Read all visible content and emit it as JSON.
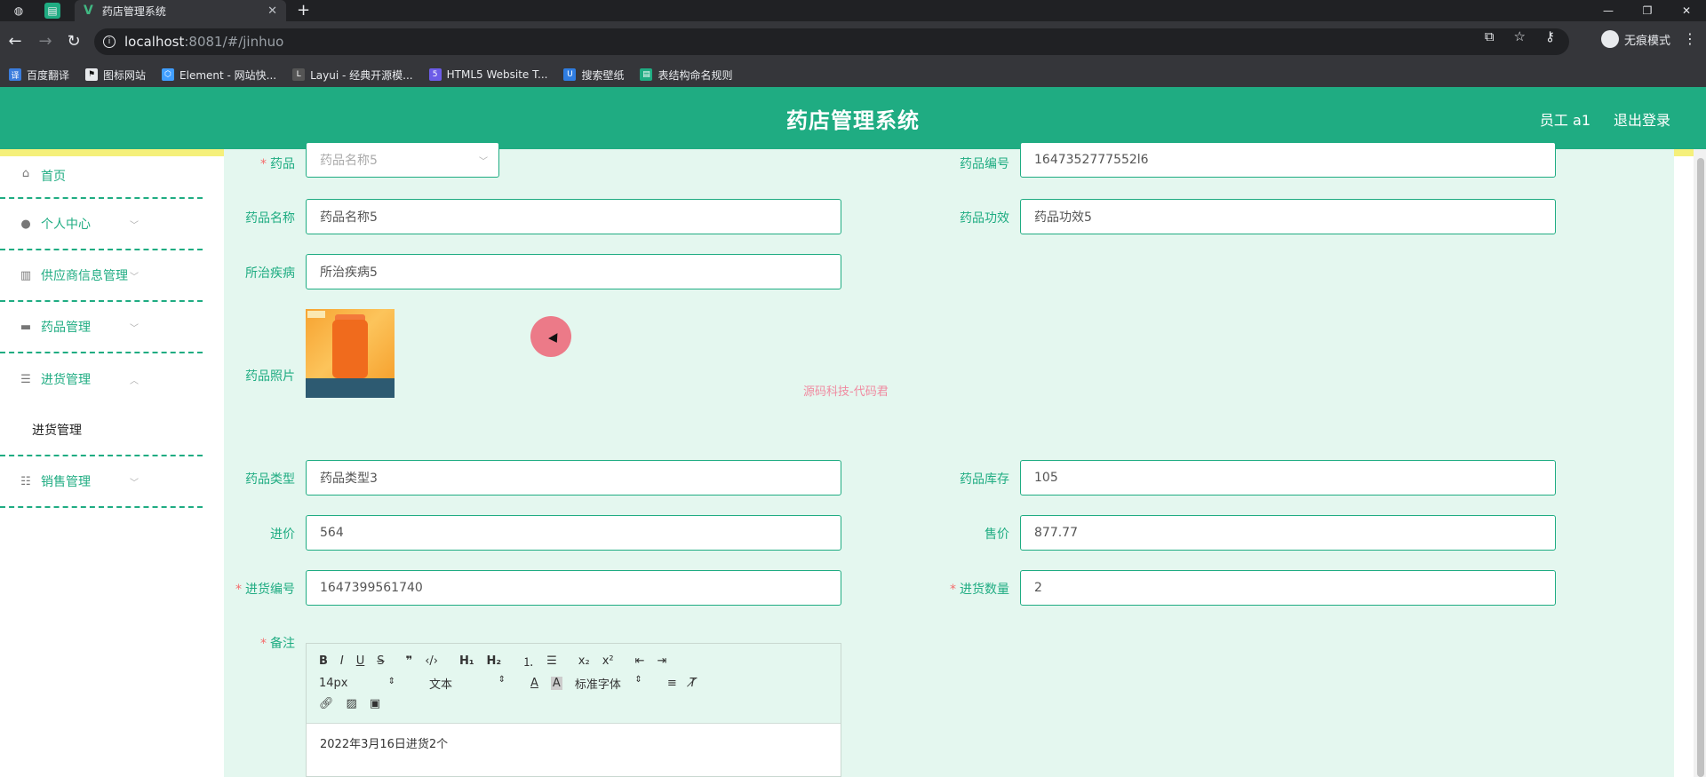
{
  "browser": {
    "tab_title": "药店管理系统",
    "url_host": "localhost",
    "url_rest": ":8081/#/jinhuo",
    "incognito_label": "无痕模式",
    "bookmarks": [
      {
        "label": "百度翻译",
        "color": "#3b7ddd",
        "icon": "translate-icon"
      },
      {
        "label": "图标网站",
        "color": "#111111",
        "icon": "flag-icon"
      },
      {
        "label": "Element - 网站快...",
        "color": "#409eff",
        "icon": "element-icon"
      },
      {
        "label": "Layui - 经典开源模...",
        "color": "#555555",
        "icon": "layui-icon"
      },
      {
        "label": "HTML5 Website T...",
        "color": "#6c5ce7",
        "icon": "html5-icon"
      },
      {
        "label": "搜索壁纸",
        "color": "#2f7de1",
        "icon": "wallpaper-icon"
      },
      {
        "label": "表结构命名规则",
        "color": "#1fac82",
        "icon": "sheet-icon"
      }
    ]
  },
  "header": {
    "title": "药店管理系统",
    "user": "员工 a1",
    "logout": "退出登录",
    "brand_color": "#1fac82"
  },
  "sidebar": {
    "items": [
      {
        "label": "首页",
        "icon": "home-icon"
      },
      {
        "label": "个人中心",
        "icon": "user-icon"
      },
      {
        "label": "供应商信息管理",
        "icon": "supplier-icon"
      },
      {
        "label": "药品管理",
        "icon": "monitor-icon"
      },
      {
        "label": "进货管理",
        "icon": "list-icon",
        "sub": "进货管理"
      },
      {
        "label": "销售管理",
        "icon": "sliders-icon"
      }
    ]
  },
  "form": {
    "drug_select": {
      "label": "药品",
      "value": "药品名称5"
    },
    "drug_code": {
      "label": "药品编号",
      "value": "1647352777552l6"
    },
    "drug_name": {
      "label": "药品名称",
      "value": "药品名称5"
    },
    "drug_effect": {
      "label": "药品功效",
      "value": "药品功效5"
    },
    "disease": {
      "label": "所治疾病",
      "value": "所治疾病5"
    },
    "photo_label": "药品照片",
    "drug_type": {
      "label": "药品类型",
      "value": "药品类型3"
    },
    "stock": {
      "label": "药品库存",
      "value": "105"
    },
    "cost_price": {
      "label": "进价",
      "value": "564"
    },
    "sale_price": {
      "label": "售价",
      "value": "877.77"
    },
    "purchase_no": {
      "label": "进货编号",
      "value": "1647399561740"
    },
    "purchase_qty": {
      "label": "进货数量",
      "value": "2"
    },
    "remark": {
      "label": "备注",
      "content": "2022年3月16日进货2个"
    }
  },
  "editor": {
    "font_size": "14px",
    "text_type": "文本",
    "font_family": "标准字体"
  },
  "watermark": "源码科技-代码君"
}
